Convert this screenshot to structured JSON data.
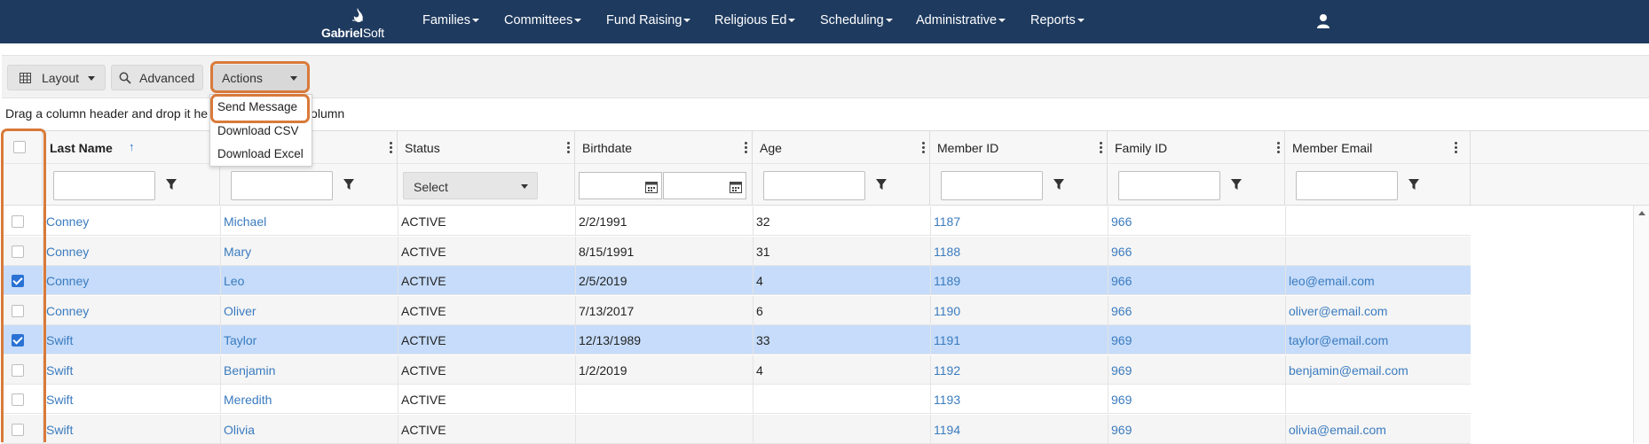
{
  "navbar": {
    "logo_bold": "Gabriel",
    "logo_regular": "Soft",
    "items": [
      "Families",
      "Committees",
      "Fund Raising",
      "Religious Ed",
      "Scheduling",
      "Administrative",
      "Reports"
    ],
    "user_icon": "user-icon",
    "bg_color": "#1e3a5f"
  },
  "toolbar": {
    "layout_label": "Layout",
    "advanced_label": "Advanced",
    "actions_label": "Actions"
  },
  "actions_menu": {
    "items": [
      "Send Message",
      "Download CSV",
      "Download Excel"
    ]
  },
  "group_bar": {
    "text_before": "Drag a column header and drop it he",
    "text_after": "column"
  },
  "grid": {
    "columns": [
      "Last Name",
      "",
      "Status",
      "Birthdate",
      "Age",
      "Member ID",
      "Family ID",
      "Member Email"
    ],
    "sort_indicator": "↑",
    "status_filter_placeholder": "Select",
    "rows": [
      {
        "checked": false,
        "last": "Conney",
        "first": "Michael",
        "status": "ACTIVE",
        "birthdate": "2/2/1991",
        "age": "32",
        "member_id": "1187",
        "family_id": "966",
        "email": ""
      },
      {
        "checked": false,
        "last": "Conney",
        "first": "Mary",
        "status": "ACTIVE",
        "birthdate": "8/15/1991",
        "age": "31",
        "member_id": "1188",
        "family_id": "966",
        "email": ""
      },
      {
        "checked": true,
        "last": "Conney",
        "first": "Leo",
        "status": "ACTIVE",
        "birthdate": "2/5/2019",
        "age": "4",
        "member_id": "1189",
        "family_id": "966",
        "email": "leo@email.com"
      },
      {
        "checked": false,
        "last": "Conney",
        "first": "Oliver",
        "status": "ACTIVE",
        "birthdate": "7/13/2017",
        "age": "6",
        "member_id": "1190",
        "family_id": "966",
        "email": "oliver@email.com"
      },
      {
        "checked": true,
        "last": "Swift",
        "first": "Taylor",
        "status": "ACTIVE",
        "birthdate": "12/13/1989",
        "age": "33",
        "member_id": "1191",
        "family_id": "969",
        "email": "taylor@email.com"
      },
      {
        "checked": false,
        "last": "Swift",
        "first": "Benjamin",
        "status": "ACTIVE",
        "birthdate": "1/2/2019",
        "age": "4",
        "member_id": "1192",
        "family_id": "969",
        "email": "benjamin@email.com"
      },
      {
        "checked": false,
        "last": "Swift",
        "first": "Meredith",
        "status": "ACTIVE",
        "birthdate": "",
        "age": "",
        "member_id": "1193",
        "family_id": "969",
        "email": ""
      },
      {
        "checked": false,
        "last": "Swift",
        "first": "Olivia",
        "status": "ACTIVE",
        "birthdate": "",
        "age": "",
        "member_id": "1194",
        "family_id": "969",
        "email": "olivia@email.com"
      }
    ]
  },
  "colors": {
    "accent_outline": "#d97a3a",
    "link": "#3a7bbf",
    "selected_row": "#c6dcfa",
    "checkbox_on": "#2a72d4"
  }
}
